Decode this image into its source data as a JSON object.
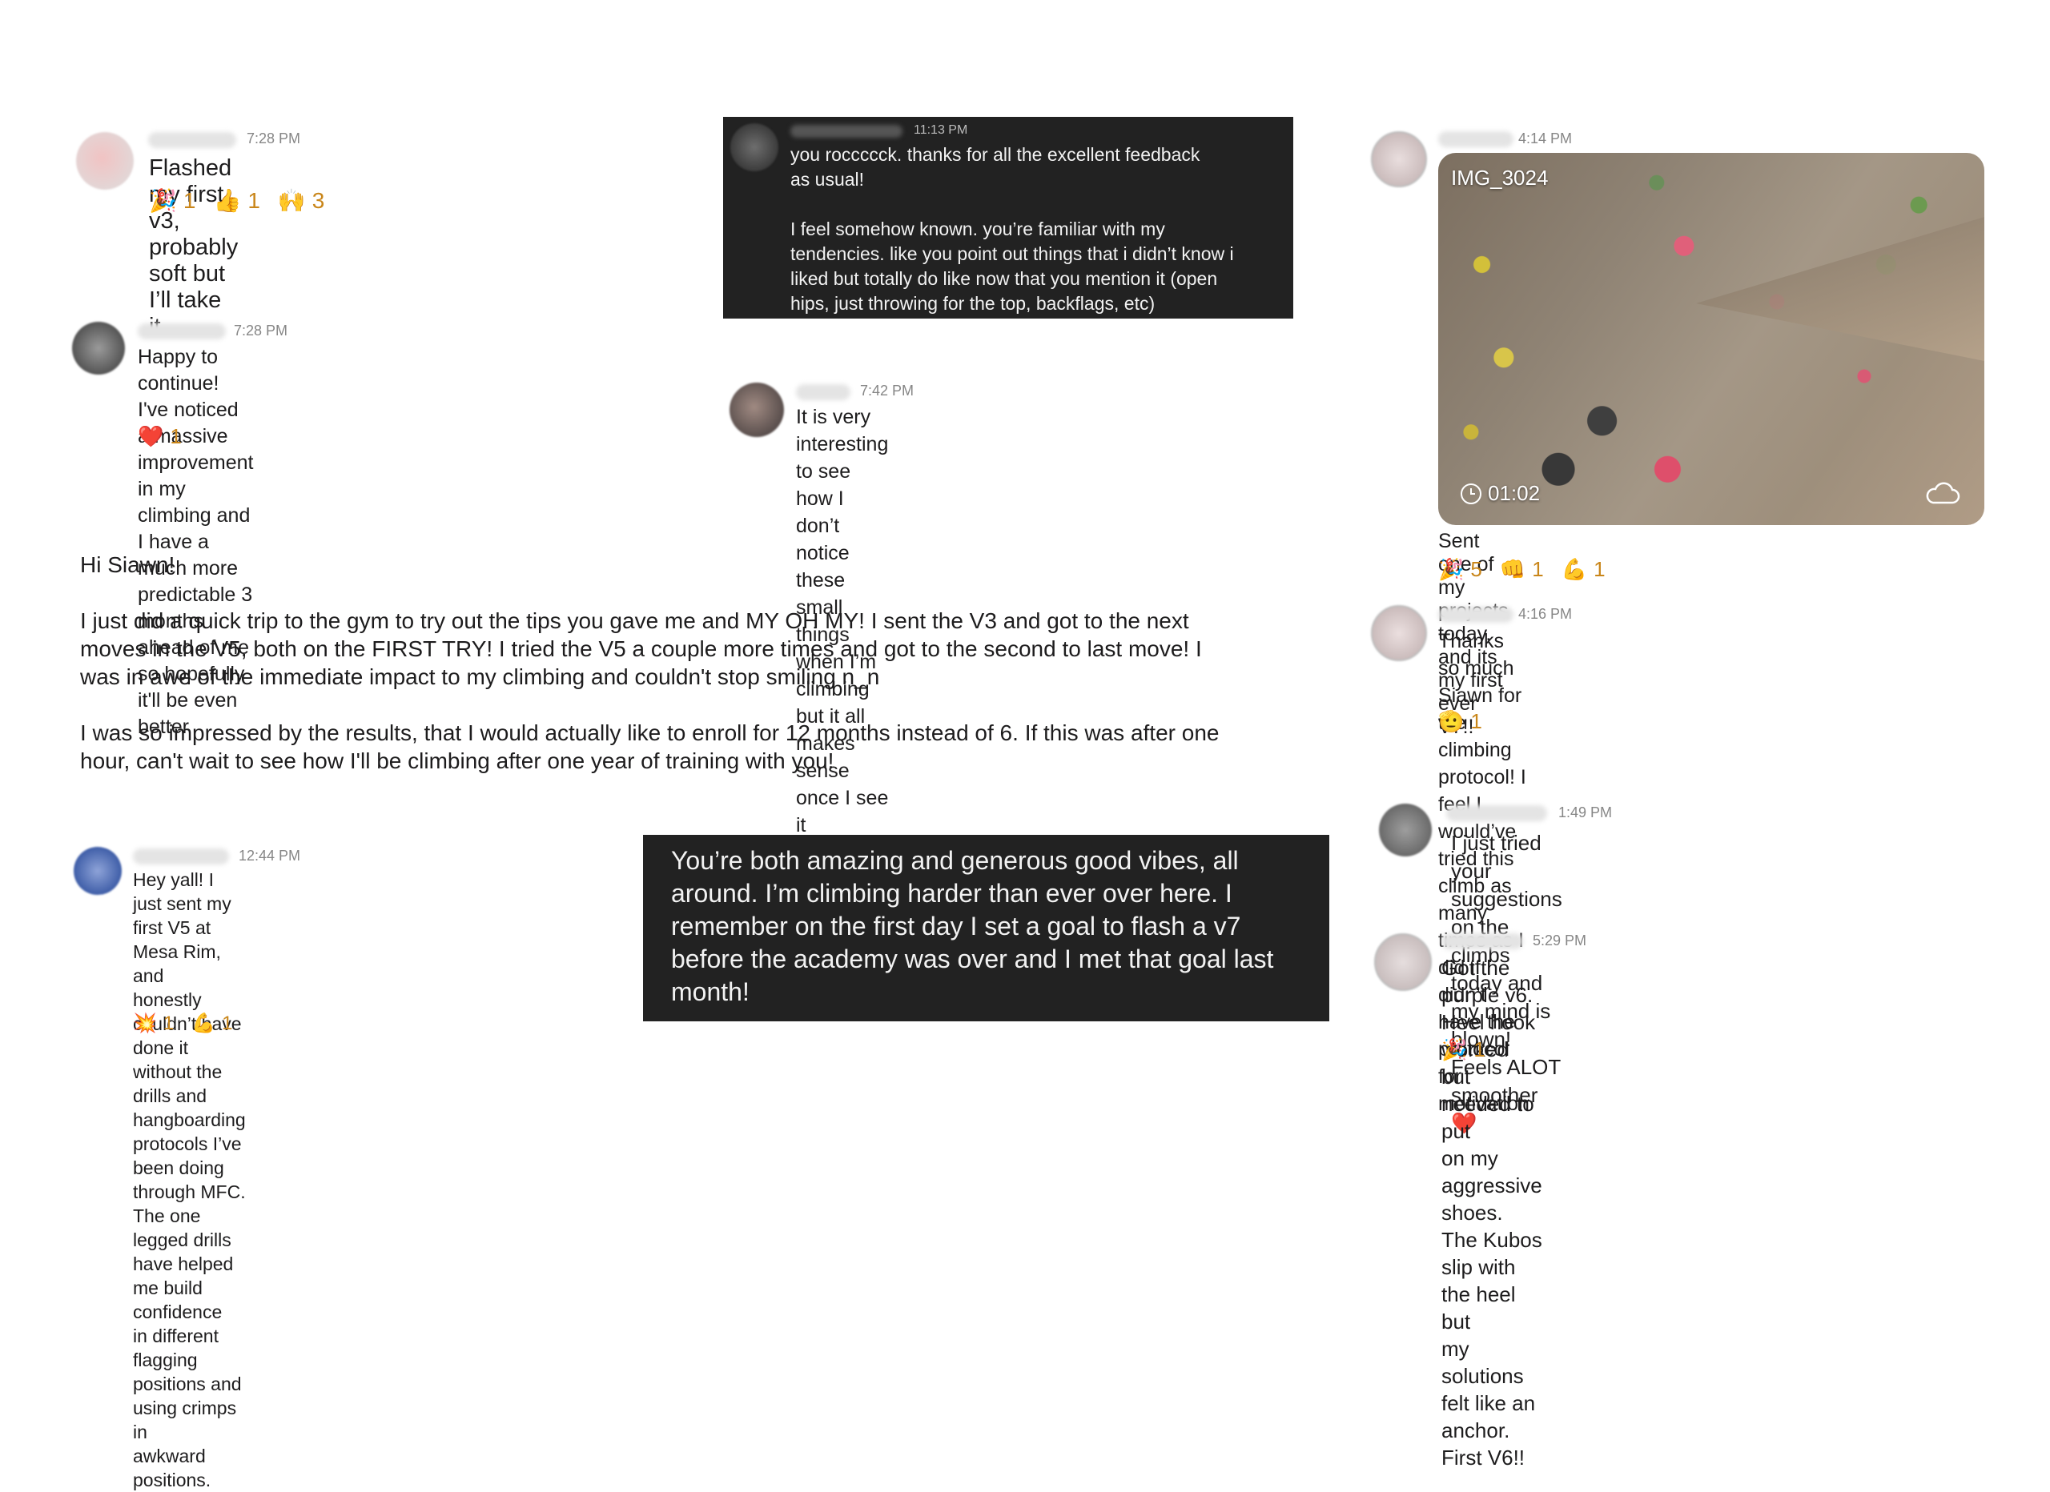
{
  "messages": {
    "m1": {
      "time": "7:28 PM",
      "text": "Flashed my first v3, probably soft but I’ll take it",
      "reactions": [
        {
          "emoji": "🎉",
          "count": "1"
        },
        {
          "emoji": "👍",
          "count": "1"
        },
        {
          "emoji": "🙌",
          "count": "3"
        }
      ]
    },
    "m2": {
      "time": "7:28 PM",
      "text": "Happy to continue! I've noticed a massive improvement\nin my climbing and I have a much more predictable 3\nmonths ahead of me so hopefully it'll be even better",
      "reactions": [
        {
          "emoji": "❤️",
          "count": "1"
        }
      ]
    },
    "m3": {
      "time": "11:13 PM",
      "text": "you roccccck. thanks for all the excellent feedback\nas usual!\n\nI feel somehow known. you’re familiar with my\ntendencies. like you point out things that i didn’t know i\nliked but totally do like now that you mention it (open\nhips, just throwing for the top, backflags, etc)"
    },
    "m4": {
      "time": "7:42 PM",
      "text": "It is very interesting to see how I don’t notice these\nsmall things when I’m climbing but it all makes sense\nonce I see it"
    },
    "m5": {
      "time": "4:14 PM",
      "video_title": "IMG_3024",
      "video_duration": "01:02",
      "text": "Sent one of my projects today, and its my first ever V7!!",
      "reactions": [
        {
          "emoji": "🎉",
          "count": "5"
        },
        {
          "emoji": "👊",
          "count": "1"
        },
        {
          "emoji": "💪",
          "count": "1"
        }
      ]
    },
    "m6": {
      "time": "4:16 PM",
      "text": "Thanks so much Siawn for the climbing protocol! I feel I\nwould’ve tried this climb as many times as I did if I didn’t\nhave the protocol for motivation",
      "reactions": [
        {
          "emoji": "🫡",
          "count": "1"
        }
      ]
    },
    "m7": {
      "text": "Hi Siawn!\n\nI just did a quick trip to the gym to try out the tips you gave me and MY OH MY! I sent the V3 and got to the next\nmoves in the V5, both on the FIRST TRY! I tried the V5 a couple more times and got to the second to last move! I\nwas in awe of the immediate impact to my climbing and couldn't stop smiling n_n\n\nI was so impressed by the results, that I would actually like to enroll for 12 months instead of 6. If this was after one\nhour, can't wait to see how I'll be climbing after one year of training with you!"
    },
    "m8": {
      "time": "1:49 PM",
      "text": "I just tried your suggestions on the climbs today and\nmy mind is blown! Feels ALOT smoother ❤️"
    },
    "m9": {
      "time": "12:44 PM",
      "text": "Hey yall! I just sent my first V5 at Mesa Rim, and\nhonestly couldn’t have done it without the drills and\nhangboarding protocols I’ve been doing through MFC.\nThe one legged drills have helped me build confidence\nin different flagging positions and using crimps in\nawkward positions.",
      "reactions": [
        {
          "emoji": "💥",
          "count": "1"
        },
        {
          "emoji": "💪",
          "count": "1"
        }
      ]
    },
    "m10": {
      "text": "You’re both amazing and generous good vibes, all\naround. I’m climbing harder than ever over here. I\nremember on the first day I set a goal to flash a v7\nbefore the academy was over and I met that goal last\nmonth!"
    },
    "m11": {
      "time": "5:29 PM",
      "text": "Got the purple v6. Heel hook worked but needed to put\non my aggressive shoes. The Kubos slip with the heel but\nmy solutions felt like an anchor. First V6!!",
      "reactions": [
        {
          "emoji": "🎉",
          "count": "1"
        }
      ]
    }
  },
  "colors": {
    "reaction_count": "#c9861a",
    "timestamp": "#868686",
    "dark_panel": "#222222"
  }
}
